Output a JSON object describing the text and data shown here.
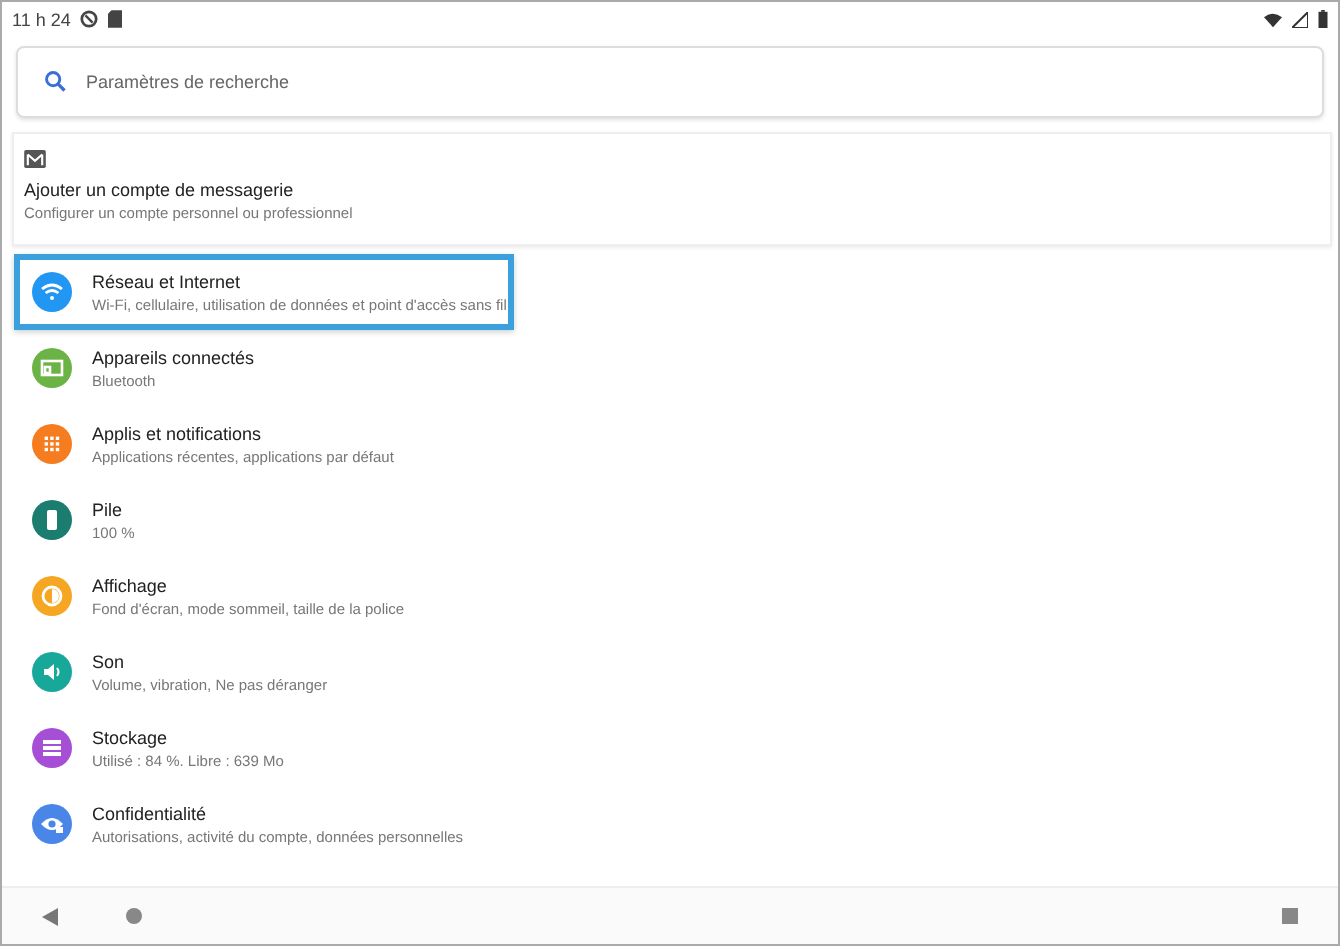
{
  "status_bar": {
    "time": "11 h 24"
  },
  "search": {
    "placeholder": "Paramètres de recherche"
  },
  "account_card": {
    "title": "Ajouter un compte de messagerie",
    "subtitle": "Configurer un compte personnel ou professionnel"
  },
  "items": [
    {
      "kind": "wifi",
      "color": "#2196f3",
      "title": "Réseau et Internet",
      "subtitle": "Wi-Fi, cellulaire, utilisation de données et point d'accès sans fil",
      "selected": true
    },
    {
      "kind": "devices",
      "color": "#6ab344",
      "title": "Appareils connectés",
      "subtitle": "Bluetooth",
      "selected": false
    },
    {
      "kind": "apps",
      "color": "#f57c1f",
      "title": "Applis et notifications",
      "subtitle": "Applications récentes, applications par défaut",
      "selected": false
    },
    {
      "kind": "battery",
      "color": "#1b7d6f",
      "title": "Pile",
      "subtitle": "100 %",
      "selected": false
    },
    {
      "kind": "display",
      "color": "#f5a623",
      "title": "Affichage",
      "subtitle": "Fond d'écran, mode sommeil, taille de la police",
      "selected": false
    },
    {
      "kind": "sound",
      "color": "#17a89a",
      "title": "Son",
      "subtitle": "Volume, vibration, Ne pas déranger",
      "selected": false
    },
    {
      "kind": "storage",
      "color": "#a64ed6",
      "title": "Stockage",
      "subtitle": "Utilisé : 84 %. Libre : 639 Mo",
      "selected": false
    },
    {
      "kind": "privacy",
      "color": "#4a86e8",
      "title": "Confidentialité",
      "subtitle": "Autorisations, activité du compte, données personnelles",
      "selected": false
    }
  ]
}
